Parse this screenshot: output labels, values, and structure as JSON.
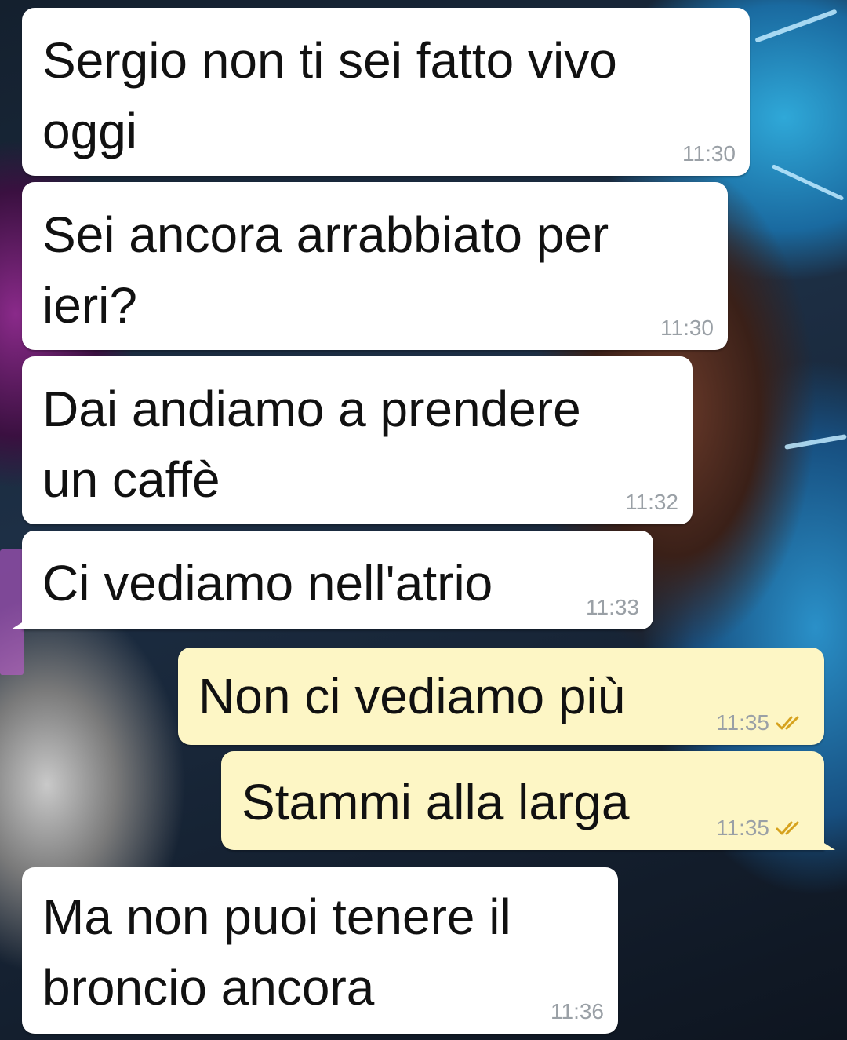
{
  "colors": {
    "incoming_bubble": "#ffffff",
    "outgoing_bubble": "#fdf6c5",
    "timestamp": "#9aa0a6",
    "read_ticks": "#d6a21e"
  },
  "messages": [
    {
      "direction": "incoming",
      "text_lines": [
        "Sergio non ti sei fatto vivo",
        "oggi"
      ],
      "time": "11:30"
    },
    {
      "direction": "incoming",
      "text_lines": [
        "Sei ancora arrabbiato per",
        "ieri?"
      ],
      "time": "11:30"
    },
    {
      "direction": "incoming",
      "text_lines": [
        "Dai andiamo a prendere",
        "un caffè"
      ],
      "time": "11:32"
    },
    {
      "direction": "incoming",
      "text_lines": [
        "Ci vediamo nell'atrio"
      ],
      "time": "11:33"
    },
    {
      "direction": "outgoing",
      "text_lines": [
        "Non ci vediamo più"
      ],
      "time": "11:35",
      "status_icon": "double-check-icon"
    },
    {
      "direction": "outgoing",
      "text_lines": [
        "Stammi alla larga"
      ],
      "time": "11:35",
      "status_icon": "double-check-icon"
    },
    {
      "direction": "incoming",
      "text_lines": [
        "Ma non puoi tenere il",
        "broncio ancora"
      ],
      "time": "11:36"
    }
  ]
}
